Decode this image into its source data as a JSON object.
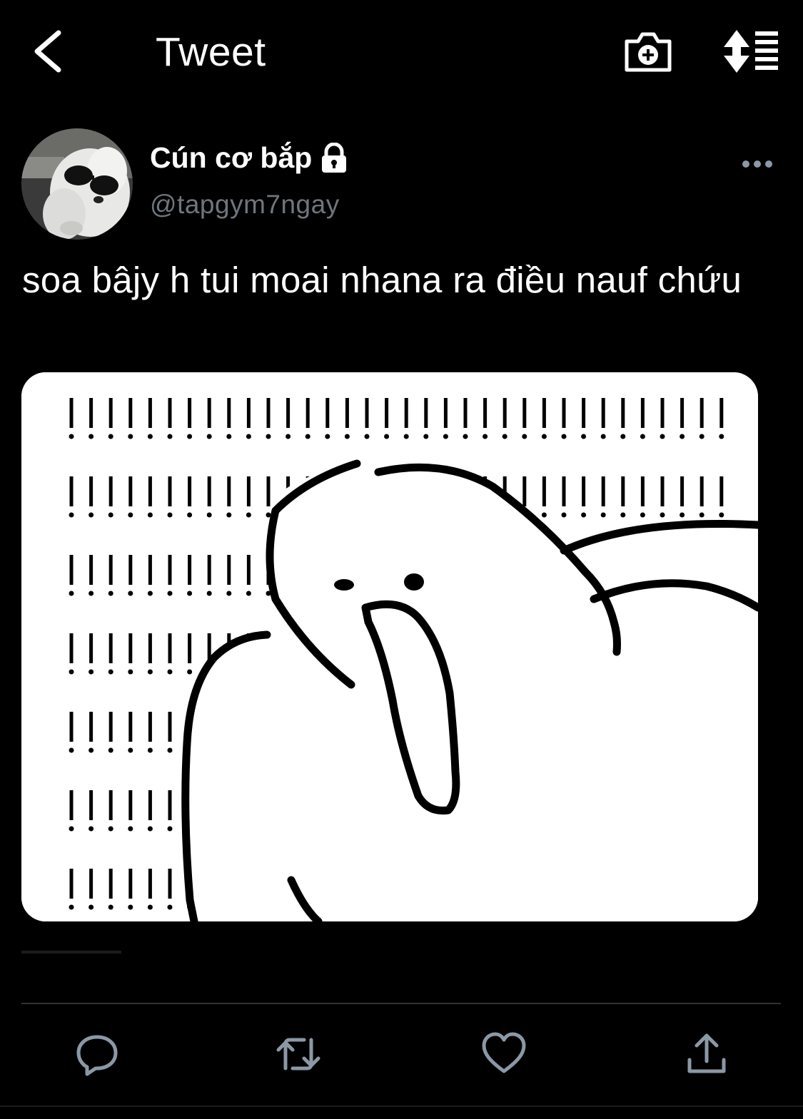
{
  "header": {
    "title": "Tweet",
    "back_icon": "chevron-left-icon",
    "camera_icon": "camera-plus-icon",
    "sort_icon": "sort-list-icon"
  },
  "tweet": {
    "author_name": "Cún cơ bắp",
    "author_locked_icon": "lock-icon",
    "handle": "@tapgym7ngay",
    "text": "soa bâjy h tui moai nhana ra điều nauf chứu",
    "more_icon": "more-horizontal-icon",
    "media_description_icon": "meme-image"
  },
  "actions": {
    "reply_icon": "reply-icon",
    "retweet_icon": "retweet-icon",
    "like_icon": "heart-icon",
    "share_icon": "share-icon"
  },
  "colors": {
    "background": "#000000",
    "text_primary": "#ffffff",
    "text_secondary": "#6e767d",
    "icon": "#8b98a5",
    "divider": "#2f3336"
  }
}
